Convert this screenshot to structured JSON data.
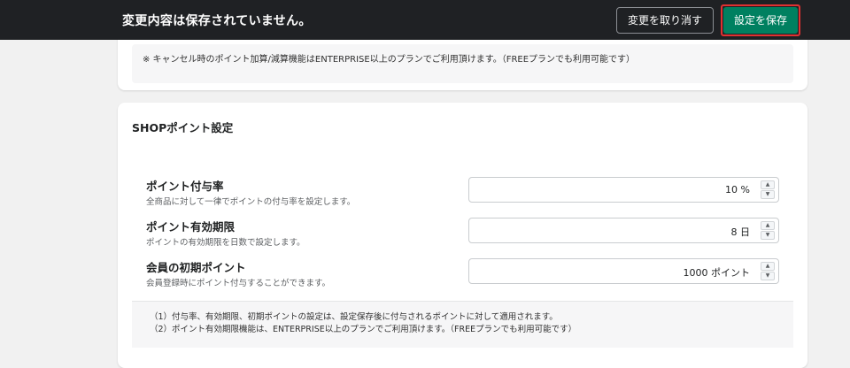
{
  "topbar": {
    "message": "変更内容は保存されていません。",
    "discard_label": "変更を取り消す",
    "save_label": "設定を保存"
  },
  "top_card": {
    "note": "※ キャンセル時のポイント加算/減算機能はENTERPRISE以上のプランでご利用頂けます。（FREEプランでも利用可能です）"
  },
  "shop_points": {
    "title": "SHOPポイント設定",
    "rows": [
      {
        "label": "ポイント付与率",
        "help": "全商品に対して一律でポイントの付与率を設定します。",
        "value": "10 %"
      },
      {
        "label": "ポイント有効期限",
        "help": "ポイントの有効期限を日数で設定します。",
        "value": "8 日"
      },
      {
        "label": "会員の初期ポイント",
        "help": "会員登録時にポイント付与することができます。",
        "value": "1000 ポイント"
      }
    ],
    "footnotes": [
      "（1）付与率、有効期限、初期ポイントの設定は、設定保存後に付与されるポイントに対して適用されます。",
      "（2）ポイント有効期限機能は、ENTERPRISE以上のプランでご利用頂けます。（FREEプランでも利用可能です）"
    ]
  },
  "icons": {
    "up": "caret-up-icon",
    "down": "caret-down-icon"
  },
  "colors": {
    "topbar_bg": "#1f2124",
    "save_bg": "#008060",
    "save_highlight": "#e03131"
  }
}
